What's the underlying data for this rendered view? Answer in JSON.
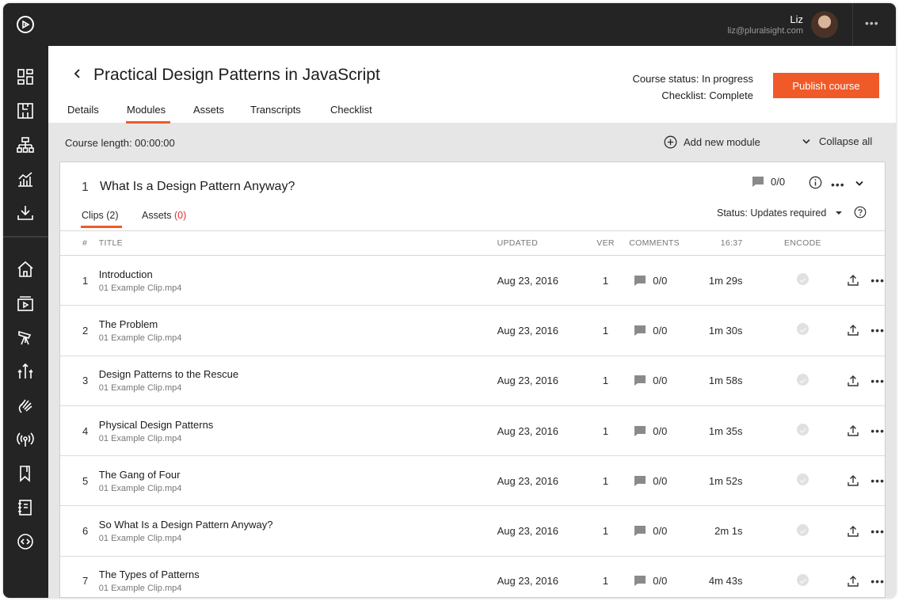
{
  "user": {
    "name": "Liz",
    "email": "liz@pluralsight.com"
  },
  "header": {
    "title": "Practical Design Patterns in JavaScript",
    "tabs": [
      {
        "label": "Details"
      },
      {
        "label": "Modules",
        "active": true
      },
      {
        "label": "Assets"
      },
      {
        "label": "Transcripts"
      },
      {
        "label": "Checklist"
      }
    ],
    "course_status": "Course status: In progress",
    "checklist_status": "Checklist: Complete",
    "publish_label": "Publish course"
  },
  "subbar": {
    "course_length": "Course length: 00:00:00",
    "add_module": "Add new module",
    "collapse_all": "Collapse all"
  },
  "module": {
    "number": "1",
    "title": "What Is a Design Pattern Anyway?",
    "comments": "0/0",
    "tabs": {
      "clips": "Clips (2)",
      "assets_label": "Assets",
      "assets_count": "(0)"
    },
    "status": "Status: Updates required"
  },
  "table": {
    "headers": {
      "num": "#",
      "title": "TITLE",
      "updated": "UPDATED",
      "ver": "VER",
      "comments": "COMMENTS",
      "length": "16:37",
      "encode": "ENCODE"
    },
    "rows": [
      {
        "num": "1",
        "title": "Introduction",
        "file": "01 Example Clip.mp4",
        "updated": "Aug 23, 2016",
        "ver": "1",
        "comments": "0/0",
        "length": "1m 29s"
      },
      {
        "num": "2",
        "title": "The Problem",
        "file": "01 Example Clip.mp4",
        "updated": "Aug 23, 2016",
        "ver": "1",
        "comments": "0/0",
        "length": "1m 30s"
      },
      {
        "num": "3",
        "title": "Design Patterns to the Rescue",
        "file": "01 Example Clip.mp4",
        "updated": "Aug 23, 2016",
        "ver": "1",
        "comments": "0/0",
        "length": "1m 58s"
      },
      {
        "num": "4",
        "title": "Physical Design Patterns",
        "file": "01 Example Clip.mp4",
        "updated": "Aug 23, 2016",
        "ver": "1",
        "comments": "0/0",
        "length": "1m 35s"
      },
      {
        "num": "5",
        "title": "The Gang of Four",
        "file": "01 Example Clip.mp4",
        "updated": "Aug 23, 2016",
        "ver": "1",
        "comments": "0/0",
        "length": "1m 52s"
      },
      {
        "num": "6",
        "title": "So What Is a Design Pattern Anyway?",
        "file": "01 Example Clip.mp4",
        "updated": "Aug 23, 2016",
        "ver": "1",
        "comments": "0/0",
        "length": "2m 1s"
      },
      {
        "num": "7",
        "title": "The Types of Patterns",
        "file": "01 Example Clip.mp4",
        "updated": "Aug 23, 2016",
        "ver": "1",
        "comments": "0/0",
        "length": "4m 43s"
      }
    ]
  },
  "sidebar": {
    "icons": [
      "dashboard-icon",
      "blueprint-icon",
      "org-chart-icon",
      "analytics-icon",
      "download-icon",
      "home-icon",
      "video-library-icon",
      "telescope-icon",
      "split-arrows-icon",
      "hand-icon",
      "broadcast-icon",
      "bookmark-icon",
      "notebook-icon",
      "code-icon"
    ]
  },
  "colors": {
    "accent": "#f05a28",
    "sidebar": "#242424",
    "assets_count": "#e22f2f"
  }
}
